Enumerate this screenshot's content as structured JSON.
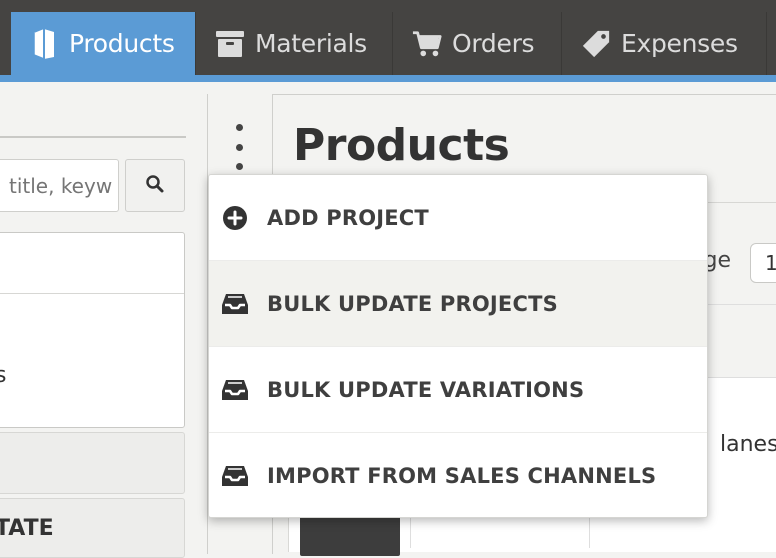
{
  "nav": {
    "tabs": [
      {
        "label": "Products",
        "icon": "book-icon",
        "active": true
      },
      {
        "label": "Materials",
        "icon": "archive-box-icon",
        "active": false
      },
      {
        "label": "Orders",
        "icon": "cart-icon",
        "active": false
      },
      {
        "label": "Expenses",
        "icon": "tag-icon",
        "active": false
      }
    ],
    "accent_color": "#5b9bd5",
    "bar_color": "#454442"
  },
  "filters": {
    "search_placeholder": "title, keyw",
    "search_icon": "search-icon",
    "list_fragment": "s",
    "state_fragment": "TATE"
  },
  "main": {
    "title": "Products",
    "per_page_label": "age",
    "per_page_value": "1",
    "row_text": "lanes"
  },
  "menu": {
    "items": [
      {
        "label": "ADD PROJECT",
        "icon": "plus-circle-icon"
      },
      {
        "label": "BULK UPDATE PROJECTS",
        "icon": "inbox-tray-icon"
      },
      {
        "label": "BULK UPDATE VARIATIONS",
        "icon": "inbox-tray-icon"
      },
      {
        "label": "IMPORT FROM SALES CHANNELS",
        "icon": "inbox-tray-icon"
      }
    ],
    "hovered_index": 1
  }
}
